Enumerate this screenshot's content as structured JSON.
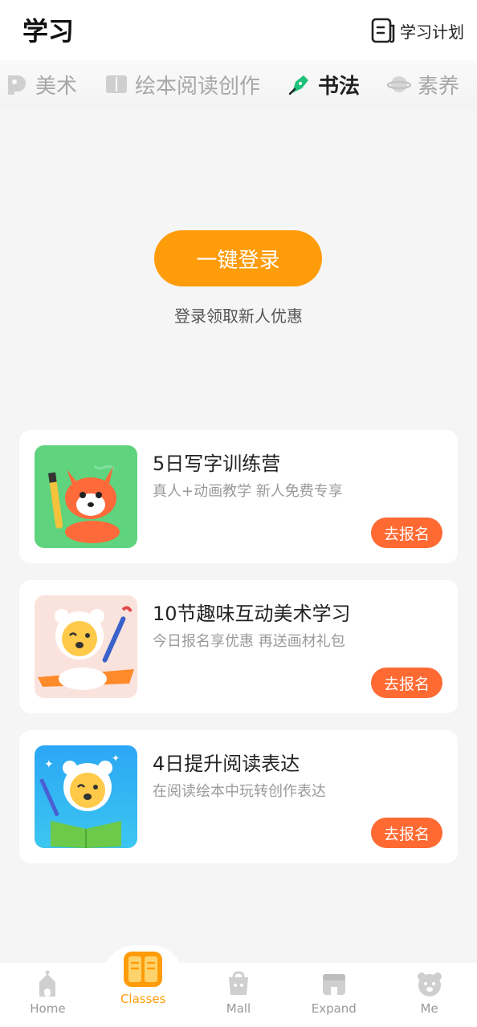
{
  "header": {
    "title": "学习",
    "plan_label": "学习计划"
  },
  "tabs": [
    {
      "label": "美术",
      "icon": "palette-icon",
      "active": false
    },
    {
      "label": "绘本阅读创作",
      "icon": "book-icon",
      "active": false
    },
    {
      "label": "书法",
      "icon": "brush-icon",
      "active": true
    },
    {
      "label": "素养",
      "icon": "planet-icon",
      "active": false
    }
  ],
  "login": {
    "button_label": "一键登录",
    "hint": "登录领取新人优惠"
  },
  "courses": [
    {
      "title": "5日写字训练营",
      "subtitle": "真人+动画教学 新人免费专享",
      "button": "去报名",
      "thumb": "fox-pencil-illustration"
    },
    {
      "title": "10节趣味互动美术学习",
      "subtitle": "今日报名享优惠 再送画材礼包",
      "button": "去报名",
      "thumb": "bear-airplane-illustration"
    },
    {
      "title": "4日提升阅读表达",
      "subtitle": "在阅读绘本中玩转创作表达",
      "button": "去报名",
      "thumb": "bear-book-illustration"
    }
  ],
  "bottom_nav": [
    {
      "label": "Home",
      "icon": "home-icon",
      "active": false
    },
    {
      "label": "Classes",
      "icon": "classes-book-icon",
      "active": true
    },
    {
      "label": "Mall",
      "icon": "mall-icon",
      "active": false
    },
    {
      "label": "Expand",
      "icon": "expand-store-icon",
      "active": false
    },
    {
      "label": "Me",
      "icon": "bear-face-icon",
      "active": false
    }
  ],
  "colors": {
    "accent_orange": "#ff9c0a",
    "enroll_orange": "#ff6a33",
    "brush_green": "#1fc27a"
  }
}
